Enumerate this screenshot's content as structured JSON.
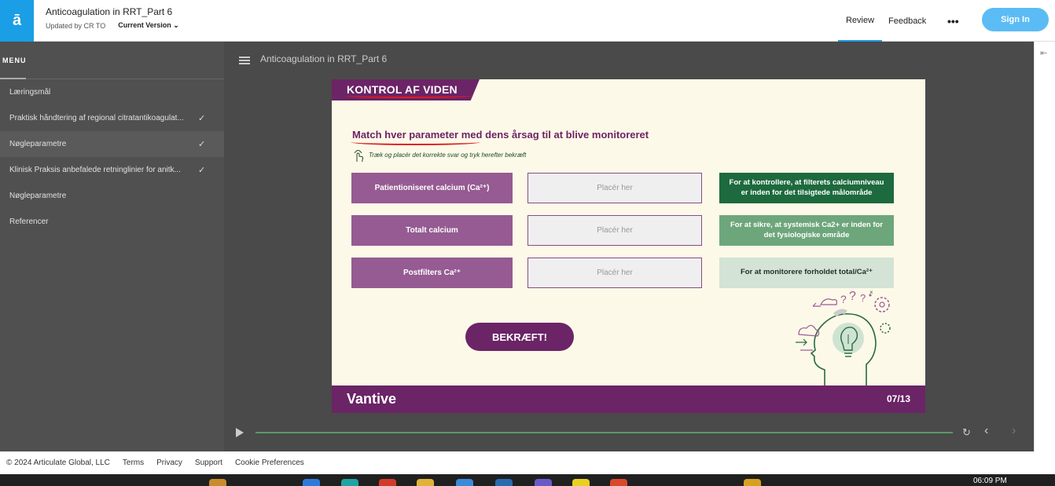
{
  "header": {
    "logo": "ā",
    "title": "Anticoagulation in RRT_Part 6",
    "updated_by": "Updated by CR TO",
    "version": "Current Version",
    "nav_review": "Review",
    "nav_feedback": "Feedback",
    "nav_more": "•••",
    "sign_in": "Sign In"
  },
  "sidebar": {
    "menu_label": "MENU",
    "items": [
      {
        "label": "Læringsmål",
        "checked": false
      },
      {
        "label": "Praktisk håndtering af regional citratantikoagulat...",
        "checked": true
      },
      {
        "label": "Nøgleparametre",
        "checked": true
      },
      {
        "label": "Klinisk Praksis anbefalede retninglinier for anitk...",
        "checked": true
      },
      {
        "label": "Nøgleparametre",
        "checked": false
      },
      {
        "label": "Referencer",
        "checked": false
      }
    ],
    "check_glyph": "✓"
  },
  "stage": {
    "lesson_title": "Anticoagulation in RRT_Part 6"
  },
  "slide": {
    "banner": "KONTROL AF VIDEN",
    "question": "Match hver parameter med dens årsag til at blive monitoreret",
    "hint": "Træk og placér det korrekte svar og tryk herefter bekræft",
    "params": [
      "Patientioniseret calcium (Ca²⁺)",
      "Totalt calcium",
      "Postfilters Ca²⁺"
    ],
    "drop_placeholder": "Placér her",
    "reasons": [
      "For at kontrollere, at filterets calciumniveau er inden for det tilsigtede målområde",
      "For at sikre, at systemisk Ca2+ er inden for det fysiologiske område",
      "For at monitorere forholdet total/Ca²⁺"
    ],
    "confirm": "BEKRÆFT!",
    "brand": "Vantive",
    "page": "07/13",
    "colors": {
      "purple": "#6b2466",
      "param": "#955b92",
      "green_dark": "#1d6a3e",
      "green_mid": "#6ea67c",
      "green_light": "#d3e3d6"
    }
  },
  "player": {
    "replay": "↻",
    "prev": "‹",
    "next": "›",
    "collapse": "⇤"
  },
  "footer": {
    "copyright": "© 2024 Articulate Global, LLC",
    "terms": "Terms",
    "privacy": "Privacy",
    "support": "Support",
    "cookies": "Cookie Preferences"
  },
  "taskbar": {
    "time": "06:09 PM"
  }
}
